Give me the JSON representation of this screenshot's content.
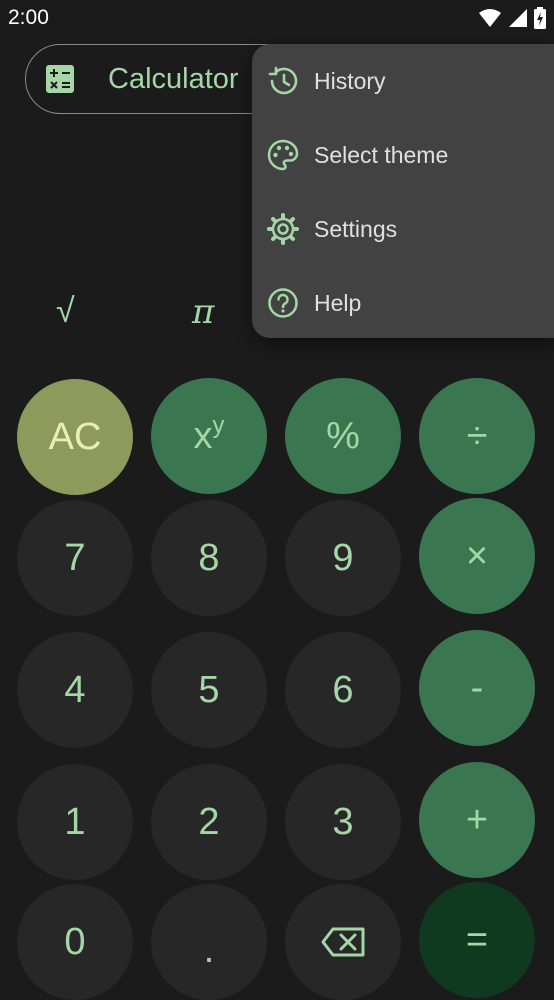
{
  "status_bar": {
    "time": "2:00",
    "wifi_icon": "wifi-icon",
    "signal_icon": "cell-signal-icon",
    "battery_icon": "battery-icon"
  },
  "header": {
    "title": "Calculator",
    "icon": "calculator-icon"
  },
  "scientific_row": {
    "sqrt": "√",
    "pi": "π"
  },
  "keypad": {
    "ac": "AC",
    "power_base": "x",
    "power_exp": "y",
    "percent": "%",
    "divide": "÷",
    "seven": "7",
    "eight": "8",
    "nine": "9",
    "multiply": "×",
    "four": "4",
    "five": "5",
    "six": "6",
    "minus": "-",
    "one": "1",
    "two": "2",
    "three": "3",
    "plus": "+",
    "zero": "0",
    "dot": ".",
    "backspace_icon": "backspace-icon",
    "equals": "="
  },
  "menu": {
    "items": [
      {
        "label": "History",
        "icon": "history-icon"
      },
      {
        "label": "Select theme",
        "icon": "palette-icon"
      },
      {
        "label": "Settings",
        "icon": "gear-icon"
      },
      {
        "label": "Help",
        "icon": "help-icon"
      }
    ]
  },
  "colors": {
    "background": "#1b1b1b",
    "accent_text": "#a5d7a6",
    "operator": "#3a7650",
    "ac": "#8e9a5b",
    "equals": "#0f3a20",
    "digit": "#272727",
    "menu": "#424242"
  }
}
